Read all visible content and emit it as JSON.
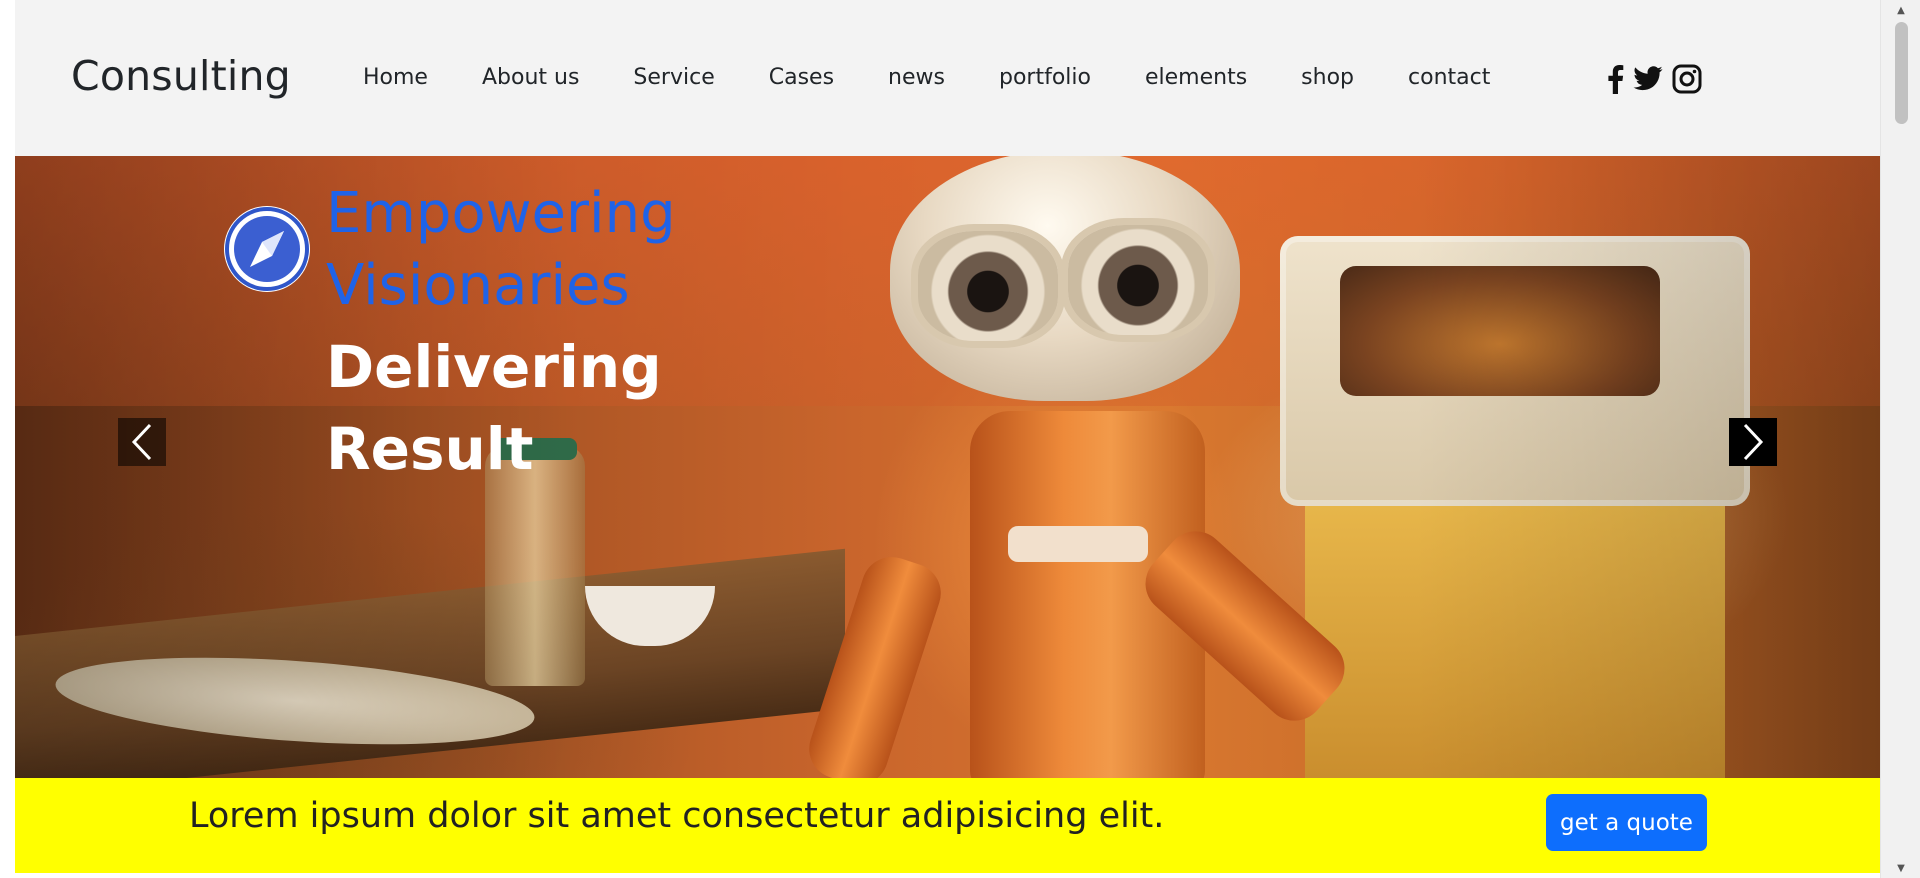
{
  "header": {
    "brand": "Consulting",
    "nav": [
      "Home",
      "About us",
      "Service",
      "Cases",
      "news",
      "portfolio",
      "elements",
      "shop",
      "contact"
    ],
    "social_icons": [
      "facebook-icon",
      "twitter-icon",
      "instagram-icon"
    ]
  },
  "hero": {
    "title_line1": "Empowering Visionaries",
    "title_line2": "Delivering Result",
    "badge_icon": "compass-icon",
    "prev_icon": "chevron-left-icon",
    "next_icon": "chevron-right-icon"
  },
  "banner": {
    "text": "Lorem ipsum dolor sit amet consectetur adipisicing elit.",
    "button_label": "get a quote"
  },
  "colors": {
    "header_bg": "#f3f3f3",
    "title_accent": "#1f63e8",
    "banner_bg": "#ffff00",
    "button_bg": "#0d6efd"
  }
}
